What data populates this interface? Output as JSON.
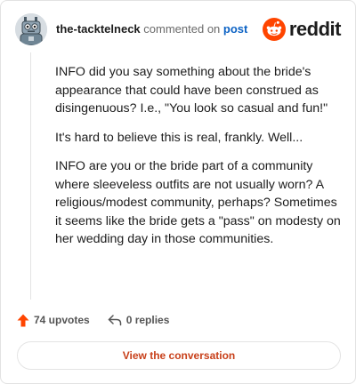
{
  "header": {
    "username": "the-tacktelneck",
    "action": "commented on",
    "target": "post",
    "logo_text": "reddit"
  },
  "comment": {
    "paragraphs": [
      "INFO did you say something about the bride's appearance that could have been construed as disingenuous? I.e., \"You look so casual and fun!\"",
      "It's hard to believe this is real, frankly. Well...",
      "INFO are you or the bride part of a community where sleeveless outfits are not usually worn? A religious/modest community, perhaps? Sometimes it seems like the bride gets a \"pass\" on modesty on her wedding day in those communities."
    ]
  },
  "footer": {
    "upvotes": "74 upvotes",
    "replies": "0 replies",
    "cta_label": "View the conversation"
  },
  "colors": {
    "brand": "#ff4500",
    "link": "#0b62c4",
    "cta": "#c8401a"
  },
  "icons": {
    "avatar": "robot-avatar",
    "logo": "reddit-snoo-icon",
    "upvote": "upvote-arrow-icon",
    "reply": "reply-arrow-icon"
  }
}
